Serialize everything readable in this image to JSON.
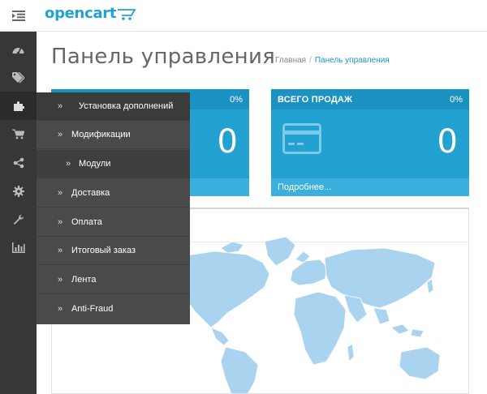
{
  "header": {
    "logo_text": "opencart"
  },
  "page": {
    "title": "Панель управления"
  },
  "breadcrumb": {
    "home": "Главная",
    "separator": "/",
    "current": "Панель управления"
  },
  "tiles": [
    {
      "title": "",
      "percent": "0%",
      "value": "0",
      "more": ""
    },
    {
      "title": "ВСЕГО ПРОДАЖ",
      "percent": "0%",
      "value": "0",
      "more": "Подробнее..."
    }
  ],
  "sidebar_icons": [
    "dashboard-icon",
    "tag-icon",
    "puzzle-icon",
    "cart-icon",
    "share-icon",
    "gear-icon",
    "wrench-icon",
    "bar-chart-icon"
  ],
  "flyout": {
    "items": [
      {
        "arrow": "»",
        "label": "Установка дополнений"
      },
      {
        "arrow": "»",
        "label": "Модификации"
      },
      {
        "arrow": "»",
        "label": "Модули"
      },
      {
        "arrow": "»",
        "label": "Доставка"
      },
      {
        "arrow": "»",
        "label": "Оплата"
      },
      {
        "arrow": "»",
        "label": "Итоговый заказ"
      },
      {
        "arrow": "»",
        "label": "Лента"
      },
      {
        "arrow": "»",
        "label": "Anti-Fraud"
      }
    ]
  },
  "colors": {
    "accent": "#23a1d1",
    "sidebar": "#373737",
    "flyout": "#4a4a4a",
    "map": "#a9d3ee"
  }
}
